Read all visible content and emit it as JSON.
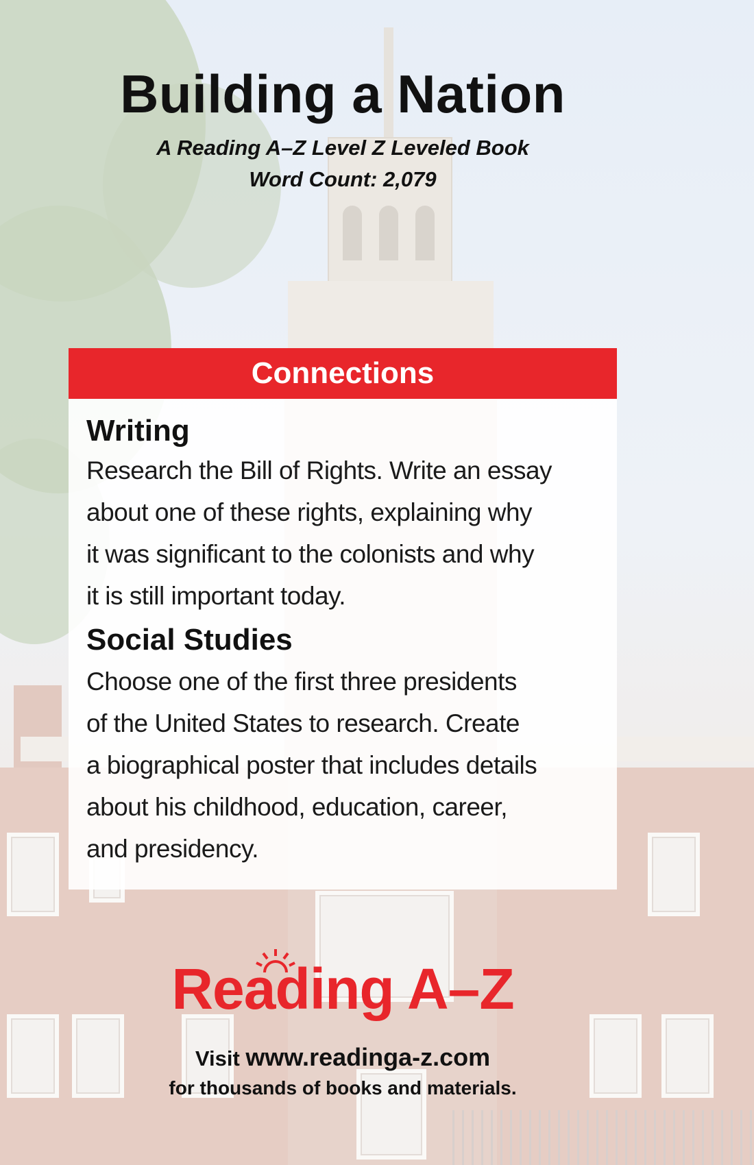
{
  "cover": {
    "title": "Building a Nation",
    "subtitle": "A Reading A–Z Level Z Leveled Book",
    "word_count": "Word Count: 2,079"
  },
  "connections": {
    "header": "Connections",
    "sections": [
      {
        "heading": "Writing",
        "lines": [
          "Research the Bill of Rights. Write an essay",
          "about one of these rights, explaining why",
          "it was significant to the colonists and why",
          "it is still important today."
        ]
      },
      {
        "heading": "Social Studies",
        "lines": [
          "Choose one of the first three presidents",
          "of the United States to research. Create",
          "a biographical poster that includes details",
          "about his childhood, education, career,",
          "and presidency."
        ]
      }
    ]
  },
  "footer": {
    "logo_text": "Reading A–Z",
    "visit_prefix": "Visit ",
    "url": "www.readinga-z.com",
    "tagline": "for thousands of books and materials."
  },
  "colors": {
    "brand_red": "#e8262b",
    "text": "#111111",
    "panel_bg": "#ffffff"
  },
  "icons": {
    "logo_mark": "sun-icon"
  }
}
